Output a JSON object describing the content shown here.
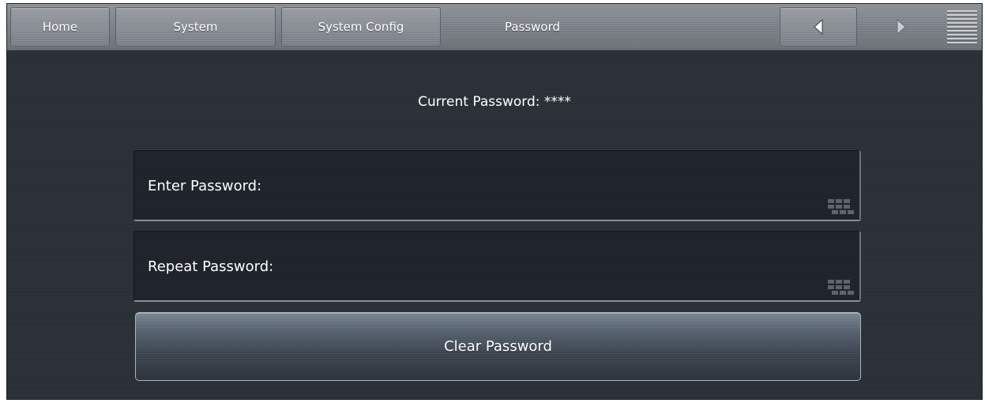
{
  "nav": {
    "breadcrumbs": [
      {
        "label": "Home"
      },
      {
        "label": "System"
      },
      {
        "label": "System Config"
      }
    ],
    "current": "Password",
    "back_icon": "chevron-left-icon",
    "forward_icon": "chevron-right-icon",
    "menu_icon": "hamburger-menu-icon"
  },
  "main": {
    "current_password_label": "Current Password: ****",
    "enter_password": {
      "label": "Enter Password:",
      "icon": "keypad-icon"
    },
    "repeat_password": {
      "label": "Repeat Password:",
      "icon": "keypad-icon"
    },
    "clear_button_label": "Clear Password"
  },
  "colors": {
    "background": "#2b3037",
    "navbar": "#7d8288",
    "field": "#1f232a",
    "button": "#55606d",
    "text": "#ffffff"
  }
}
